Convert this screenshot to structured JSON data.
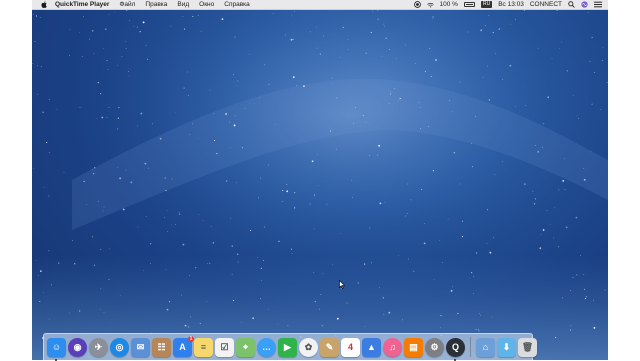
{
  "menubar": {
    "app_name": "QuickTime Player",
    "menus": [
      "Файл",
      "Правка",
      "Вид",
      "Окно",
      "Справка"
    ],
    "status": {
      "battery": "100 %",
      "input_source": "RU",
      "time": "Вс 13:03",
      "user": "CONNECT"
    }
  },
  "dock": {
    "items": [
      {
        "name": "finder",
        "color": "#2d8ef0",
        "glyph": "☺",
        "running": true
      },
      {
        "name": "siri",
        "color": "#5a3fb8",
        "glyph": "◉"
      },
      {
        "name": "launchpad",
        "color": "#8a8f99",
        "glyph": "✈"
      },
      {
        "name": "safari",
        "color": "#1e88e5",
        "glyph": "◎"
      },
      {
        "name": "mail",
        "color": "#5b8fd6",
        "glyph": "✉"
      },
      {
        "name": "contacts",
        "color": "#b5865a",
        "glyph": "☷"
      },
      {
        "name": "app-store",
        "color": "#2f80ed",
        "glyph": "A",
        "badge": "1"
      },
      {
        "name": "notes",
        "color": "#f5d76e",
        "glyph": "≡"
      },
      {
        "name": "reminders",
        "color": "#f3f3f3",
        "glyph": "☑"
      },
      {
        "name": "maps",
        "color": "#7cc26b",
        "glyph": "⌖"
      },
      {
        "name": "messages-bubble",
        "color": "#3aa0f5",
        "glyph": "…"
      },
      {
        "name": "facetime",
        "color": "#2fb34a",
        "glyph": "▶"
      },
      {
        "name": "photos",
        "color": "#f2f2f2",
        "glyph": "✿"
      },
      {
        "name": "preview",
        "color": "#c9a46a",
        "glyph": "✎"
      },
      {
        "name": "calendar",
        "color": "#ffffff",
        "glyph": "4"
      },
      {
        "name": "keynote",
        "color": "#3b7de0",
        "glyph": "▲"
      },
      {
        "name": "itunes",
        "color": "#f06292",
        "glyph": "♫"
      },
      {
        "name": "ibooks",
        "color": "#f57c00",
        "glyph": "▤"
      },
      {
        "name": "system-preferences",
        "color": "#7d7f84",
        "glyph": "⚙"
      },
      {
        "name": "quicktime-player",
        "color": "#2b2f38",
        "glyph": "Q",
        "running": true
      }
    ],
    "right_items": [
      {
        "name": "home-folder",
        "color": "#6f9fd8",
        "glyph": "⌂"
      },
      {
        "name": "downloads-folder",
        "color": "#5fb4ea",
        "glyph": "⬇"
      },
      {
        "name": "trash",
        "color": "#d9dde2",
        "glyph": "🗑"
      }
    ]
  }
}
